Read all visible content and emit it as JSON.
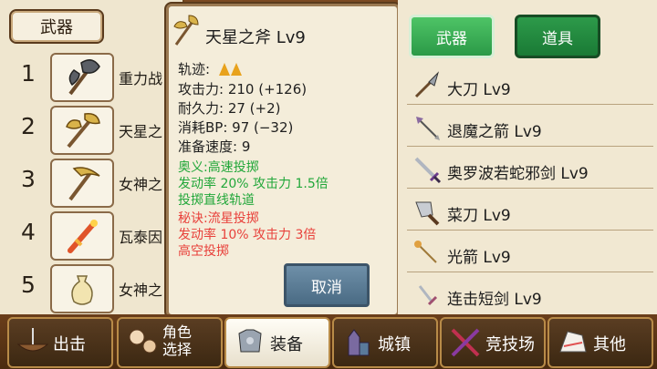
{
  "left_panel": {
    "tab_label": "武器",
    "slots": [
      {
        "num": "1",
        "name": "重力战",
        "icon": "axe-icon"
      },
      {
        "num": "2",
        "name": "天星之",
        "icon": "halberd-icon"
      },
      {
        "num": "3",
        "name": "女神之",
        "icon": "pickaxe-icon"
      },
      {
        "num": "4",
        "name": "瓦泰因",
        "icon": "flame-sword-icon"
      },
      {
        "num": "5",
        "name": "女神之",
        "icon": "pouch-icon"
      }
    ]
  },
  "detail": {
    "title": "天星之斧  Lv9",
    "trajectory_label": "轨迹:",
    "attack": "攻击力: 210  (+126)",
    "durability": "耐久力: 27  (+2)",
    "bp_cost": "消耗BP: 97  (−32)",
    "prep_speed": "准备速度:  9",
    "skill1_name": "奥义:高速投掷",
    "skill1_stats": "发动率 20%    攻击力  1.5倍",
    "skill1_desc": "投掷直线轨道",
    "skill2_name": "秘诀:流星投掷",
    "skill2_stats": "发动率  10%    攻击力  3倍",
    "skill2_desc": "高空投掷",
    "cancel_label": "取消"
  },
  "right_panel": {
    "tab_weapon": "武器",
    "tab_item": "道具",
    "items": [
      {
        "label": "大刀  Lv9",
        "icon": "glaive-icon"
      },
      {
        "label": "退魔之箭  Lv9",
        "icon": "arrow-icon"
      },
      {
        "label": "奥罗波若蛇邪剑  Lv9",
        "icon": "sword-icon"
      },
      {
        "label": "菜刀  Lv9",
        "icon": "cleaver-icon"
      },
      {
        "label": "光箭  Lv9",
        "icon": "light-arrow-icon"
      },
      {
        "label": "连击短剑  Lv9",
        "icon": "dagger-icon"
      }
    ]
  },
  "bottom_nav": {
    "items": [
      {
        "label": "出击",
        "icon": "ship-icon"
      },
      {
        "label": "角色\n选择",
        "label_line1": "角色",
        "label_line2": "选择",
        "icon": "character-icon"
      },
      {
        "label": "装备",
        "icon": "armor-icon"
      },
      {
        "label": "城镇",
        "icon": "castle-icon"
      },
      {
        "label": "竞技场",
        "icon": "crossed-swords-icon"
      },
      {
        "label": "其他",
        "icon": "gloves-icon"
      }
    ],
    "active_index": 2
  },
  "colors": {
    "skill1": "#22a73a",
    "skill2": "#e8413b",
    "tab_active": "#2b9a47",
    "cancel_button": "#4a6b84"
  }
}
